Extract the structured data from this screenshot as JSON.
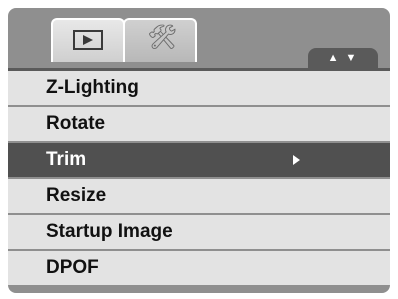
{
  "tabs": [
    {
      "icon": "play-icon",
      "label": "Playback",
      "active": true
    },
    {
      "icon": "tools-icon",
      "label": "Setup",
      "active": false
    }
  ],
  "nav_indicator": "▲ ▼",
  "menu": {
    "items": [
      {
        "label": "Z-Lighting"
      },
      {
        "label": "Rotate"
      },
      {
        "label": "Trim",
        "selected": true,
        "has_submenu": true
      },
      {
        "label": "Resize"
      },
      {
        "label": "Startup Image"
      },
      {
        "label": "DPOF"
      }
    ]
  },
  "colors": {
    "panel": "#8f8f8f",
    "row": "#e3e3e3",
    "selected_row": "#505050",
    "text": "#111111",
    "selected_text": "#ffffff"
  }
}
